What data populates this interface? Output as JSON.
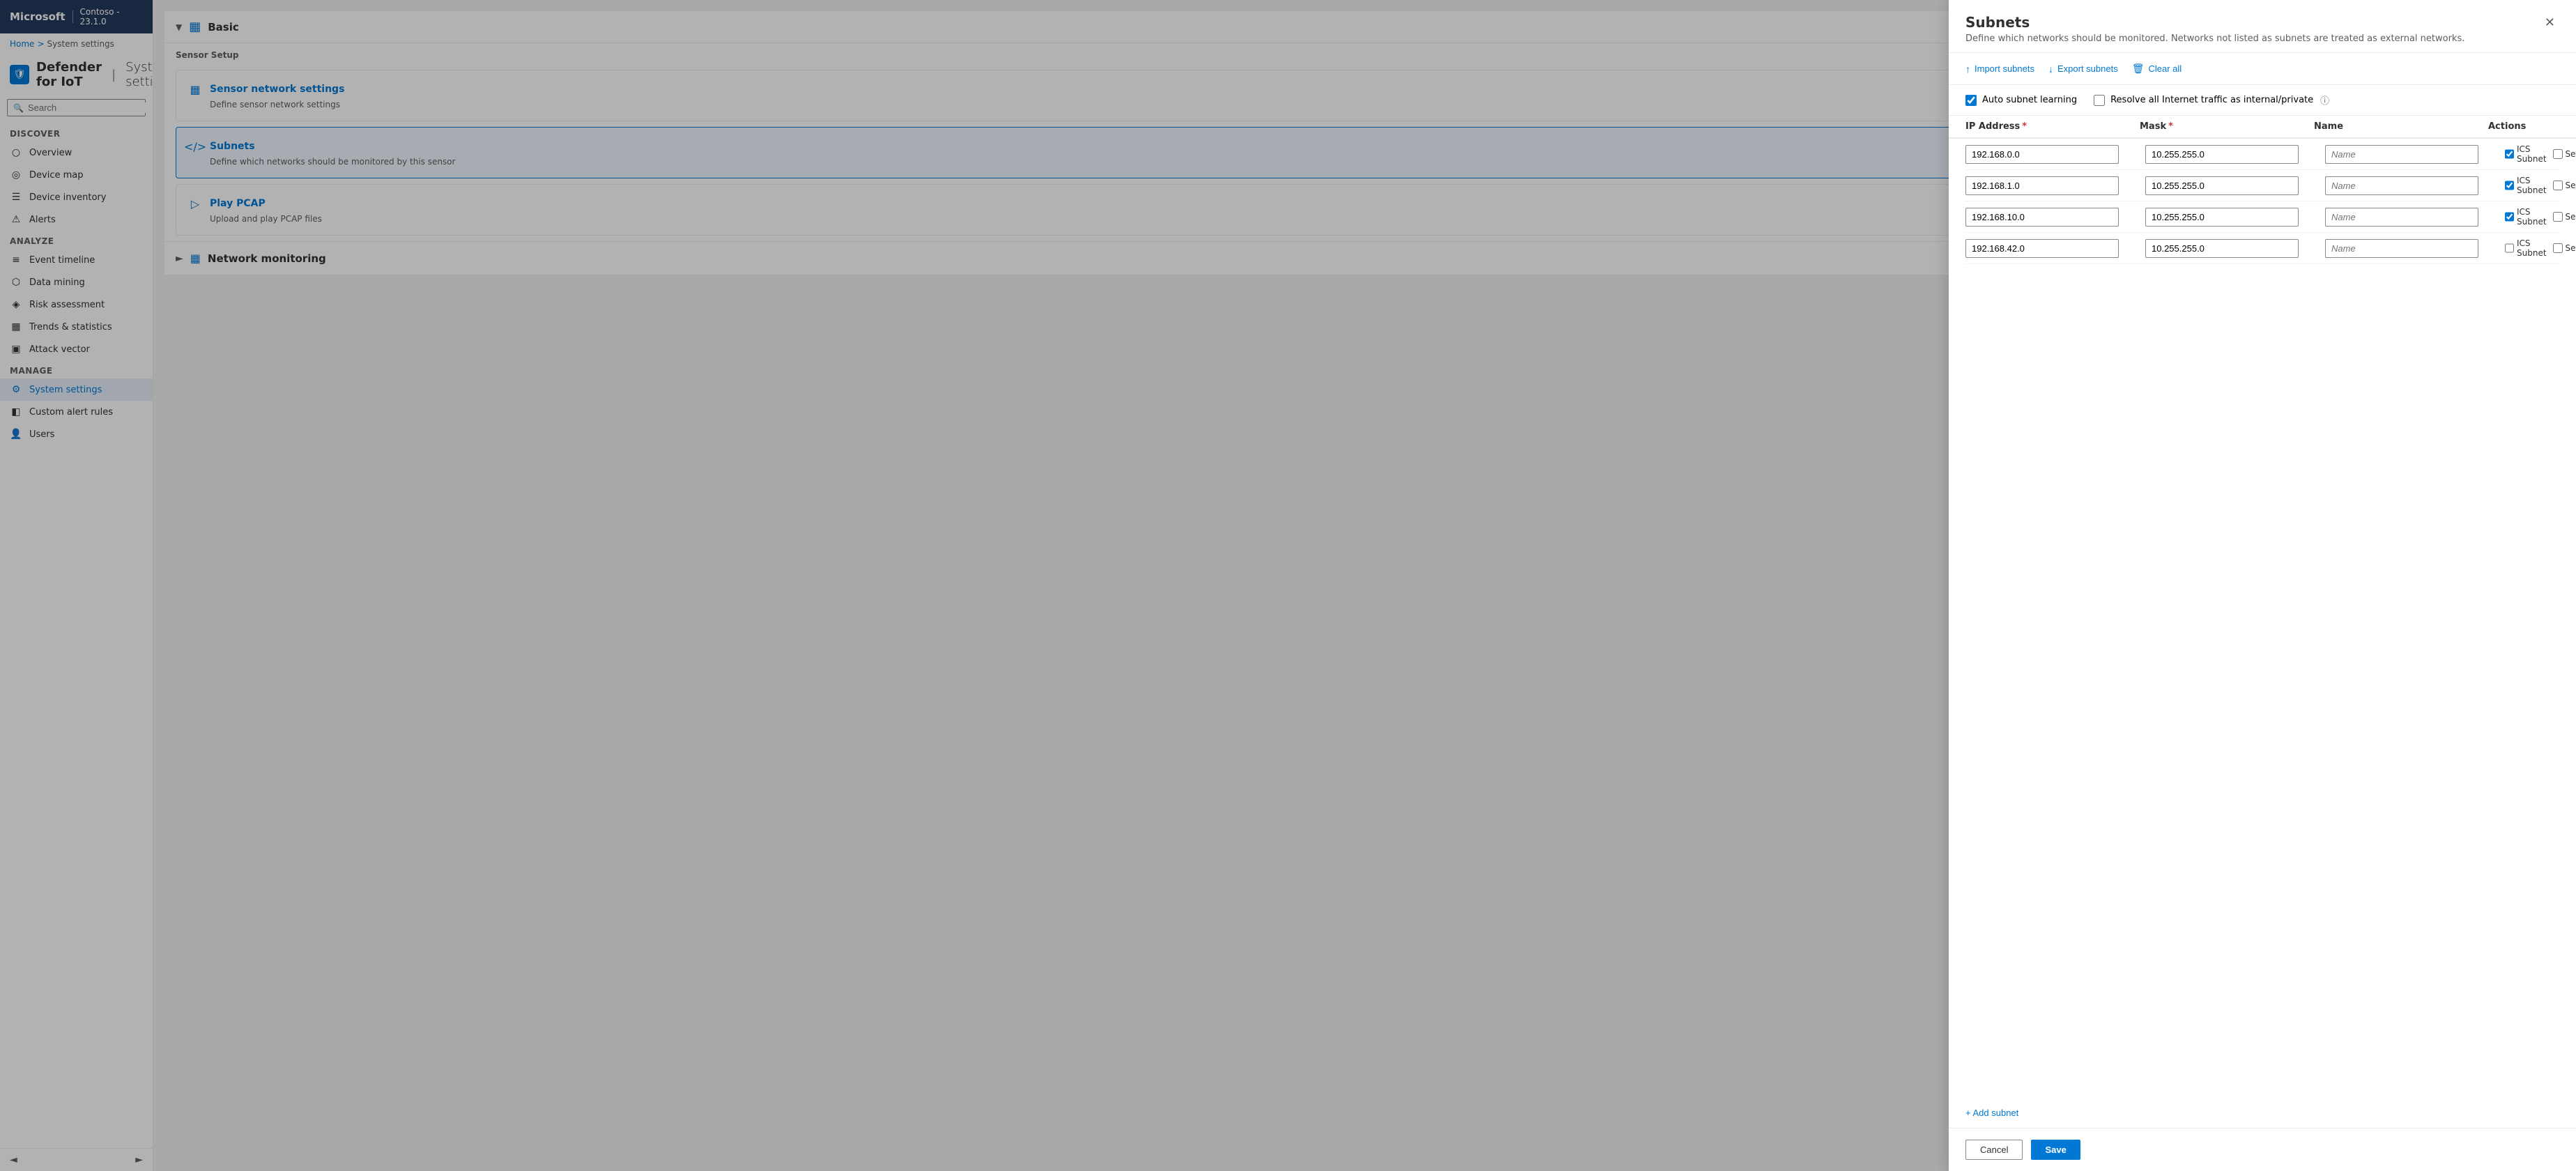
{
  "app": {
    "brand": "Microsoft",
    "product": "Defender for IoT",
    "separator": "|",
    "page_title": "System settings",
    "version_label": "Contoso - 23.1.0"
  },
  "breadcrumb": {
    "home": "Home",
    "sep": ">",
    "current": "System settings"
  },
  "sidebar": {
    "search_placeholder": "Search",
    "section_discover": "Discover",
    "section_analyze": "Analyze",
    "section_manage": "Manage",
    "nav_items": [
      {
        "id": "overview",
        "label": "Overview",
        "icon": "○"
      },
      {
        "id": "device-map",
        "label": "Device map",
        "icon": "◎"
      },
      {
        "id": "device-inventory",
        "label": "Device inventory",
        "icon": "☰"
      },
      {
        "id": "alerts",
        "label": "Alerts",
        "icon": "⚠"
      },
      {
        "id": "event-timeline",
        "label": "Event timeline",
        "icon": "≡"
      },
      {
        "id": "data-mining",
        "label": "Data mining",
        "icon": "⬡"
      },
      {
        "id": "risk-assessment",
        "label": "Risk assessment",
        "icon": "◈"
      },
      {
        "id": "trends-statistics",
        "label": "Trends & statistics",
        "icon": "▦"
      },
      {
        "id": "attack-vector",
        "label": "Attack vector",
        "icon": "▣"
      },
      {
        "id": "system-settings",
        "label": "System settings",
        "icon": "⚙",
        "active": true
      },
      {
        "id": "custom-alert-rules",
        "label": "Custom alert rules",
        "icon": "◧"
      },
      {
        "id": "users",
        "label": "Users",
        "icon": "👤"
      }
    ]
  },
  "settings": {
    "basic_section": "Basic",
    "sensor_setup_label": "Sensor Setup",
    "sensor_network_card": {
      "title": "Sensor network settings",
      "desc": "Define sensor network settings",
      "icon": "▦"
    },
    "subnets_card": {
      "title": "Subnets",
      "desc": "Define which networks should be monitored by this sensor",
      "icon": "<>"
    },
    "play_pcap_card": {
      "title": "Play PCAP",
      "desc": "Upload and play PCAP files",
      "icon": "▷"
    },
    "network_monitoring_label": "Network monitoring"
  },
  "subnets_panel": {
    "title": "Subnets",
    "description": "Define which networks should be monitored. Networks not listed as subnets are treated as external networks.",
    "import_label": "Import subnets",
    "export_label": "Export subnets",
    "clear_all_label": "Clear all",
    "auto_subnet_learning": "Auto subnet learning",
    "resolve_internet_traffic": "Resolve all Internet traffic as internal/private",
    "col_ip": "IP Address",
    "col_mask": "Mask",
    "col_name": "Name",
    "col_actions": "Actions",
    "required_mark": "*",
    "rows": [
      {
        "ip": "192.168.0.0",
        "mask": "10.255.255.0",
        "name": "",
        "ics_checked": true,
        "seg_checked": false
      },
      {
        "ip": "192.168.1.0",
        "mask": "10.255.255.0",
        "name": "",
        "ics_checked": true,
        "seg_checked": false
      },
      {
        "ip": "192.168.10.0",
        "mask": "10.255.255.0",
        "name": "",
        "ics_checked": true,
        "seg_checked": false
      },
      {
        "ip": "192.168.42.0",
        "mask": "10.255.255.0",
        "name": "",
        "ics_checked": false,
        "seg_checked": false
      }
    ],
    "name_placeholder": "Name",
    "ics_label": "ICS Subnet",
    "seg_label": "Segregated",
    "add_subnet": "+ Add subnet",
    "cancel_label": "Cancel",
    "save_label": "Save"
  }
}
